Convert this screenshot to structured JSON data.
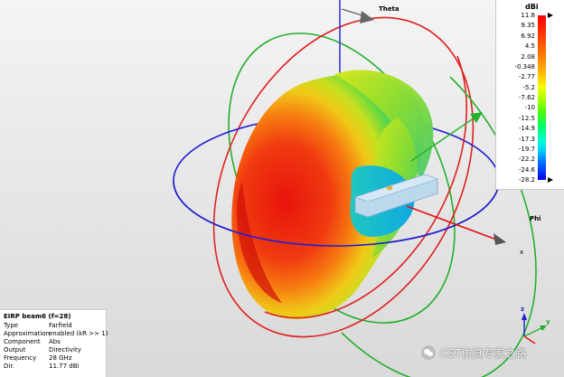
{
  "axes": {
    "theta_label": "Theta",
    "phi_label": "Phi",
    "z_label": "z",
    "y_label": "y",
    "x_label": "x"
  },
  "legend": {
    "unit": "dBi",
    "ticks": [
      "11.8",
      "9.35",
      "6.92",
      "4.5",
      "2.08",
      "-0.348",
      "-2.77",
      "-5.2",
      "-7.62",
      "-10",
      "-12.5",
      "-14.9",
      "-17.3",
      "-19.7",
      "-22.2",
      "-24.6",
      "-28.2"
    ]
  },
  "info": {
    "title": "EIRP beam6 (f=28)",
    "rows": [
      {
        "key": "Type",
        "value": "Farfield"
      },
      {
        "key": "Approximation",
        "value": "enabled (kR >> 1)"
      },
      {
        "key": "Component",
        "value": "Abs"
      },
      {
        "key": "Output",
        "value": "Directivity"
      },
      {
        "key": "Frequency",
        "value": "28 GHz"
      },
      {
        "key": "Dir.",
        "value": "11.77 dBi"
      }
    ]
  },
  "watermark": {
    "text": "CST仿真专家之路"
  },
  "colors": {
    "green_ring": "#22b02a",
    "red_ring": "#e02020",
    "blue_ring": "#2020d0",
    "phi_arrow": "#e01010"
  }
}
